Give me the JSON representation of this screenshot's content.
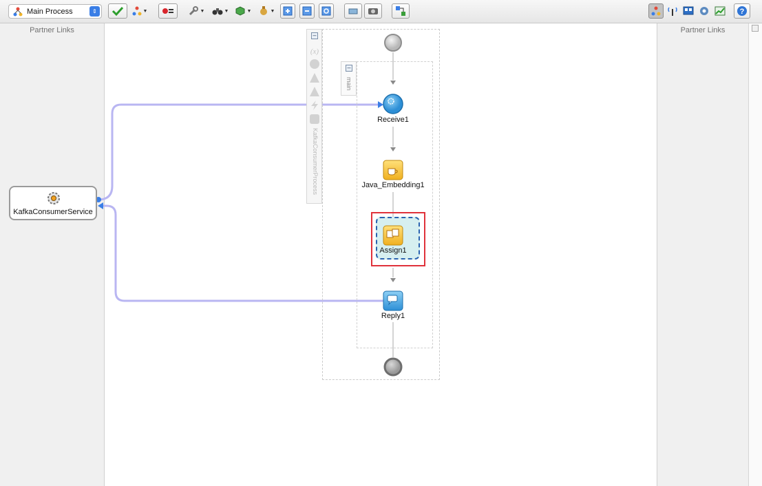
{
  "toolbar": {
    "process_select": "Main Process"
  },
  "panels": {
    "left_title": "Partner Links",
    "right_title": "Partner Links"
  },
  "partner_link": {
    "name": "KafkaConsumerService"
  },
  "process": {
    "name": "KafkaConsumerProcess",
    "scope_label": "main",
    "activities": [
      {
        "label": "Receive1",
        "icon": "receive-icon"
      },
      {
        "label": "Java_Embedding1",
        "icon": "java-embedding-icon"
      },
      {
        "label": "Assign1",
        "icon": "assign-icon"
      },
      {
        "label": "Reply1",
        "icon": "reply-icon"
      }
    ]
  },
  "colors": {
    "link_line": "#b9b6f2",
    "selection_highlight": "#e0313a",
    "selection_fill": "#d6eff0"
  }
}
